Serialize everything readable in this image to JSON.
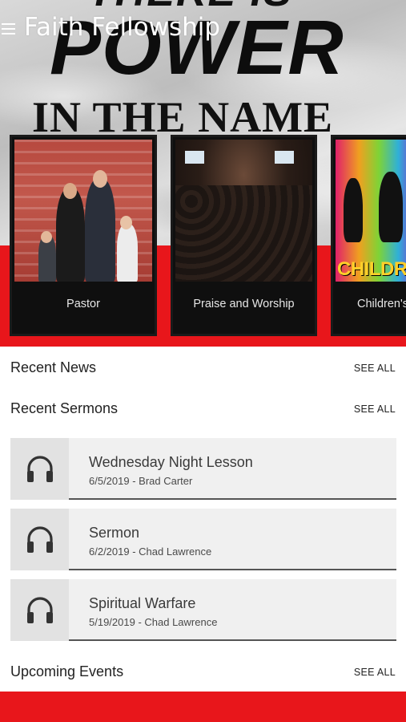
{
  "header": {
    "title": "Faith Fellowship",
    "menu_icon": "hamburger-menu-icon"
  },
  "hero": {
    "line_top": "THERE IS",
    "line_main": "POWER",
    "line_bottom": "IN THE NAME"
  },
  "carousel": {
    "items": [
      {
        "label": "Pastor"
      },
      {
        "label": "Praise and Worship"
      },
      {
        "label": "Children's",
        "image_text": "CHILDREN'S"
      }
    ]
  },
  "sections": {
    "recent_news": {
      "title": "Recent News",
      "see_all": "SEE ALL"
    },
    "recent_sermons": {
      "title": "Recent Sermons",
      "see_all": "SEE ALL"
    },
    "upcoming_events": {
      "title": "Upcoming Events",
      "see_all": "SEE ALL"
    }
  },
  "sermons": [
    {
      "title": "Wednesday Night Lesson",
      "meta": "6/5/2019 - Brad Carter",
      "icon": "headphones-icon"
    },
    {
      "title": "Sermon",
      "meta": "6/2/2019 - Chad Lawrence",
      "icon": "headphones-icon"
    },
    {
      "title": "Spiritual Warfare",
      "meta": "5/19/2019 - Chad Lawrence",
      "icon": "headphones-icon"
    }
  ],
  "colors": {
    "accent_red": "#e8161b",
    "row_bg": "#f0f0f0",
    "icon_bg": "#e2e2e2"
  }
}
